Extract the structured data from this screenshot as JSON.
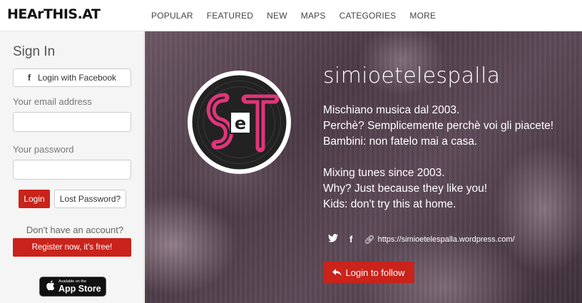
{
  "header": {
    "logo": "HEArTHIS.AT",
    "nav": [
      "POPULAR",
      "FEATURED",
      "NEW",
      "MAPS",
      "CATEGORIES",
      "MORE"
    ]
  },
  "sidebar": {
    "title": "Sign In",
    "facebook_label": "Login with Facebook",
    "facebook_icon": "f",
    "email_label": "Your email address",
    "email_value": "",
    "password_label": "Your password",
    "password_value": "",
    "login_label": "Login",
    "lost_password_label": "Lost Password?",
    "no_account_text": "Don't have an account?",
    "register_label": "Register now, it's free!",
    "appstore_small": "Available on the",
    "appstore_big": "App Store"
  },
  "profile": {
    "username": "simioetelespalla",
    "bio": [
      "Mischiano musica dal 2003.",
      "Perchè? Semplicemente perchè voi gli piacete!",
      "Bambini: non fatelo mai a casa.",
      "",
      "Mixing tunes since 2003.",
      "Why? Just because they like you!",
      "Kids: don't try this at home."
    ],
    "website": "https://simioetelespalla.wordpress.com/",
    "follow_label": "Login to follow",
    "avatar_text": "SeT"
  },
  "colors": {
    "accent": "#c9231b",
    "avatar_pink": "#e0357a",
    "avatar_dark": "#222222"
  }
}
